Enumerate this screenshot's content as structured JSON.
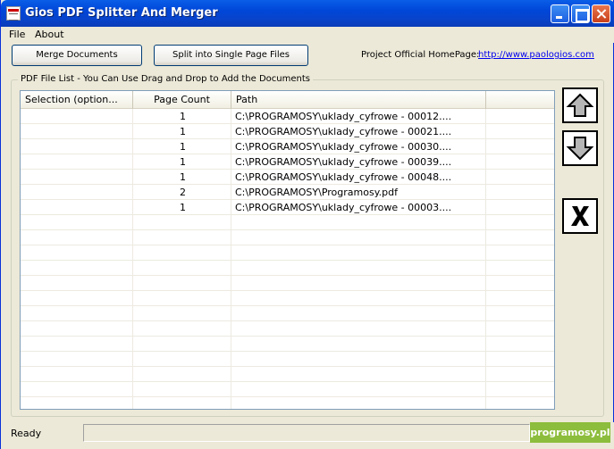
{
  "window": {
    "title": "Gios PDF Splitter And Merger"
  },
  "menu": {
    "items": [
      "File",
      "About"
    ]
  },
  "toolbar": {
    "merge_label": "Merge Documents",
    "split_label": "Split into Single Page Files",
    "homepage_label": "Project Official HomePage:",
    "homepage_link": "http://www.paologios.com"
  },
  "group": {
    "legend": "PDF File List - You Can Use Drag and Drop to Add the Documents"
  },
  "list": {
    "headers": [
      "Selection (option...",
      "Page Count",
      "Path"
    ],
    "rows": [
      {
        "selection": "",
        "count": "1",
        "path": "C:\\PROGRAMOSY\\uklady_cyfrowe - 00012...."
      },
      {
        "selection": "",
        "count": "1",
        "path": "C:\\PROGRAMOSY\\uklady_cyfrowe - 00021...."
      },
      {
        "selection": "",
        "count": "1",
        "path": "C:\\PROGRAMOSY\\uklady_cyfrowe - 00030...."
      },
      {
        "selection": "",
        "count": "1",
        "path": "C:\\PROGRAMOSY\\uklady_cyfrowe - 00039...."
      },
      {
        "selection": "",
        "count": "1",
        "path": "C:\\PROGRAMOSY\\uklady_cyfrowe - 00048...."
      },
      {
        "selection": "",
        "count": "2",
        "path": "C:\\PROGRAMOSY\\Programosy.pdf"
      },
      {
        "selection": "",
        "count": "1",
        "path": "C:\\PROGRAMOSY\\uklady_cyfrowe - 00003...."
      }
    ],
    "empty_rows": 13
  },
  "side_buttons": {
    "up_icon": "arrow-up-icon",
    "down_icon": "arrow-down-icon",
    "remove_icon": "delete-x-icon"
  },
  "status": {
    "text": "Ready"
  },
  "watermark": {
    "text": "programosy.pl"
  }
}
